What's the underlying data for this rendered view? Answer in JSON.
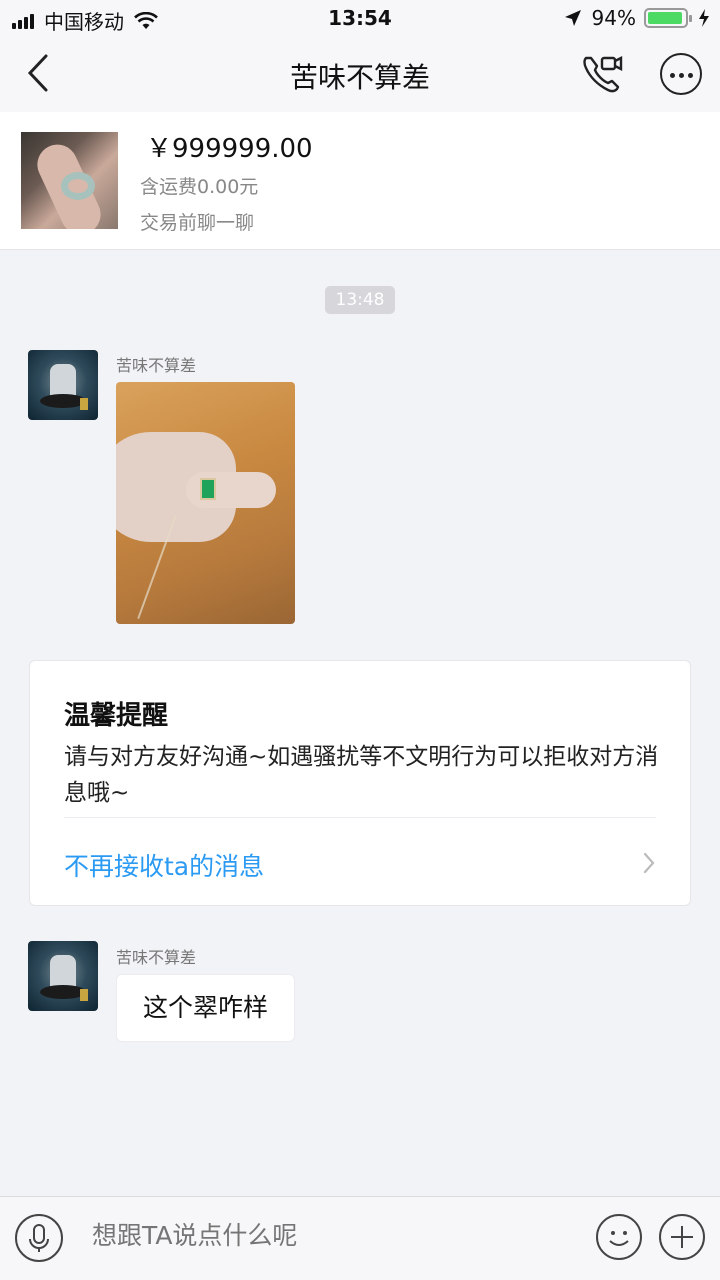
{
  "status_bar": {
    "carrier": "中国移动",
    "time": "13:54",
    "battery_percent": "94%",
    "battery_level": 0.94
  },
  "nav": {
    "title": "苦味不算差"
  },
  "product": {
    "price": "￥999999.00",
    "shipping": "含运费0.00元",
    "chat_hint": "交易前聊一聊"
  },
  "chat": {
    "timestamp": "13:48",
    "messages": [
      {
        "sender": "苦味不算差",
        "type": "image"
      },
      {
        "sender": "苦味不算差",
        "type": "text",
        "text": "这个翠咋样"
      }
    ]
  },
  "reminder": {
    "title": "温馨提醒",
    "body": "请与对方友好沟通~如遇骚扰等不文明行为可以拒收对方消息哦~",
    "link": "不再接收ta的消息"
  },
  "input": {
    "placeholder": "想跟TA说点什么呢"
  },
  "colors": {
    "link": "#2b9af3",
    "battery": "#4cd964",
    "background": "#f2f3f7"
  }
}
